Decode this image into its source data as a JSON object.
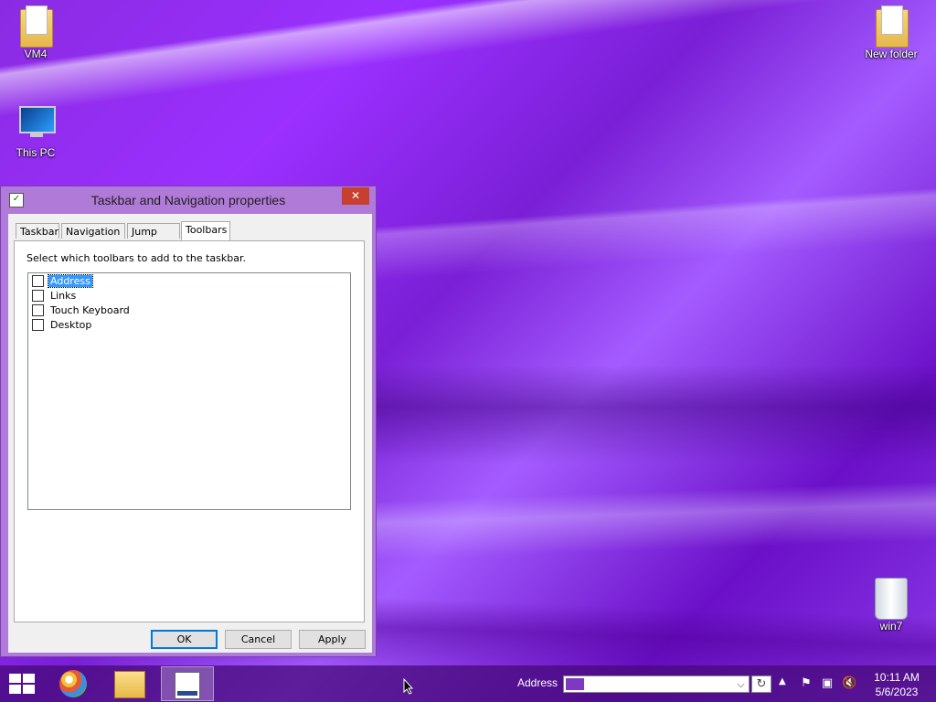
{
  "desktop": {
    "icons": [
      {
        "label": "VM4"
      },
      {
        "label": "This PC"
      },
      {
        "label": "New folder"
      },
      {
        "label": "win7"
      }
    ]
  },
  "dialog": {
    "title": "Taskbar and Navigation properties",
    "close_label": "✕",
    "tabs": [
      {
        "label": "Taskbar"
      },
      {
        "label": "Navigation"
      },
      {
        "label": "Jump Lists"
      },
      {
        "label": "Toolbars",
        "active": true
      }
    ],
    "instructions": "Select which toolbars to add to the taskbar.",
    "toolbars": [
      {
        "label": "Address",
        "checked": false,
        "selected": true
      },
      {
        "label": "Links",
        "checked": false
      },
      {
        "label": "Touch Keyboard",
        "checked": false
      },
      {
        "label": "Desktop",
        "checked": false
      }
    ],
    "buttons": {
      "ok": "OK",
      "cancel": "Cancel",
      "apply": "Apply"
    }
  },
  "taskbar": {
    "address_label": "Address",
    "address_value": "",
    "clock": {
      "time": "10:11 AM",
      "date": "5/6/2023"
    },
    "accent_color": "#7d3ac1"
  }
}
